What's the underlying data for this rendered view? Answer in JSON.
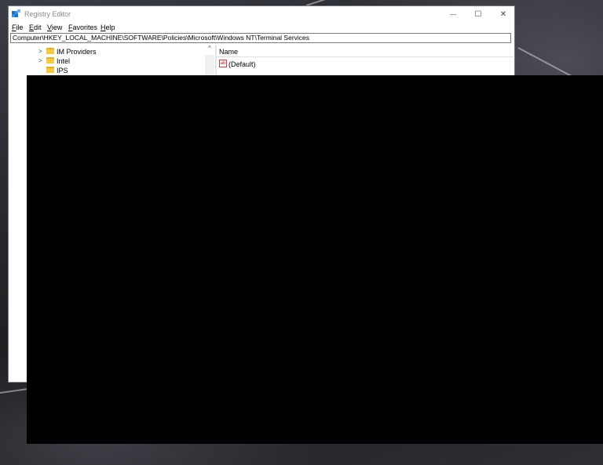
{
  "window": {
    "title": "Registry Editor",
    "controls": {
      "minimize": "—",
      "maximize": "☐",
      "close": "✕"
    }
  },
  "menu": [
    {
      "label": "File",
      "accel": "F",
      "rest": "ile"
    },
    {
      "label": "Edit",
      "accel": "E",
      "rest": "dit"
    },
    {
      "label": "View",
      "accel": "V",
      "rest": "iew"
    },
    {
      "label": "Favorites",
      "accel": "F",
      "rest": "avorites"
    },
    {
      "label": "Help",
      "accel": "H",
      "rest": "elp"
    }
  ],
  "address": "Computer\\HKEY_LOCAL_MACHINE\\SOFTWARE\\Policies\\Microsoft\\Windows NT\\Terminal Services",
  "tree": {
    "items": [
      {
        "label": "IM Providers",
        "chevron": ">"
      },
      {
        "label": "Intel",
        "chevron": ">"
      },
      {
        "label": "IPS",
        "chevron": ""
      }
    ],
    "scroll_up": "^"
  },
  "values": {
    "column_name": "Name",
    "rows": [
      {
        "name": "(Default)",
        "icon": "ab"
      }
    ]
  },
  "colors": {
    "folder": "#f5c944",
    "overlay": "#000000",
    "accent": "#1a73c8"
  }
}
